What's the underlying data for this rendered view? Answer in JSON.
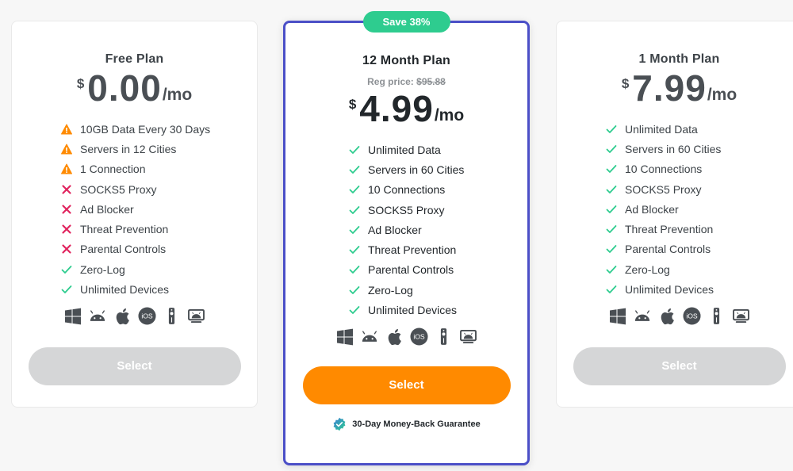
{
  "colors": {
    "accent_border": "#4b4fc7",
    "badge_bg": "#2ecc8f",
    "cta_orange": "#ff8a00",
    "disabled_button": "#d5d6d7",
    "check": "#2ecc8f",
    "cross": "#e0245e",
    "warning": "#ff8a00"
  },
  "plans": [
    {
      "title": "Free Plan",
      "currency": "$",
      "amount": "0.00",
      "per": "/mo",
      "features": [
        {
          "label": "10GB Data Every 30 Days",
          "status": "warning"
        },
        {
          "label": "Servers in 12 Cities",
          "status": "warning"
        },
        {
          "label": "1 Connection",
          "status": "warning"
        },
        {
          "label": "SOCKS5 Proxy",
          "status": "cross"
        },
        {
          "label": "Ad Blocker",
          "status": "cross"
        },
        {
          "label": "Threat Prevention",
          "status": "cross"
        },
        {
          "label": "Parental Controls",
          "status": "cross"
        },
        {
          "label": "Zero-Log",
          "status": "check"
        },
        {
          "label": "Unlimited Devices",
          "status": "check"
        }
      ],
      "select_label": "Select"
    },
    {
      "badge": "Save 38%",
      "title": "12 Month Plan",
      "reg_price_label": "Reg price:",
      "reg_price_value": "$95.88",
      "currency": "$",
      "amount": "4.99",
      "per": "/mo",
      "features": [
        {
          "label": "Unlimited Data",
          "status": "check"
        },
        {
          "label": "Servers in 60 Cities",
          "status": "check"
        },
        {
          "label": "10 Connections",
          "status": "check"
        },
        {
          "label": "SOCKS5 Proxy",
          "status": "check"
        },
        {
          "label": "Ad Blocker",
          "status": "check"
        },
        {
          "label": "Threat Prevention",
          "status": "check"
        },
        {
          "label": "Parental Controls",
          "status": "check"
        },
        {
          "label": "Zero-Log",
          "status": "check"
        },
        {
          "label": "Unlimited Devices",
          "status": "check"
        }
      ],
      "select_label": "Select",
      "guarantee": "30-Day Money-Back Guarantee"
    },
    {
      "title": "1 Month Plan",
      "currency": "$",
      "amount": "7.99",
      "per": "/mo",
      "features": [
        {
          "label": "Unlimited Data",
          "status": "check"
        },
        {
          "label": "Servers in 60 Cities",
          "status": "check"
        },
        {
          "label": "10 Connections",
          "status": "check"
        },
        {
          "label": "SOCKS5 Proxy",
          "status": "check"
        },
        {
          "label": "Ad Blocker",
          "status": "check"
        },
        {
          "label": "Threat Prevention",
          "status": "check"
        },
        {
          "label": "Parental Controls",
          "status": "check"
        },
        {
          "label": "Zero-Log",
          "status": "check"
        },
        {
          "label": "Unlimited Devices",
          "status": "check"
        }
      ],
      "select_label": "Select"
    }
  ],
  "platforms": [
    {
      "name": "windows-icon"
    },
    {
      "name": "android-icon"
    },
    {
      "name": "apple-icon"
    },
    {
      "name": "ios-icon",
      "label": "iOS"
    },
    {
      "name": "fire-tv-remote-icon"
    },
    {
      "name": "android-tv-icon"
    }
  ]
}
